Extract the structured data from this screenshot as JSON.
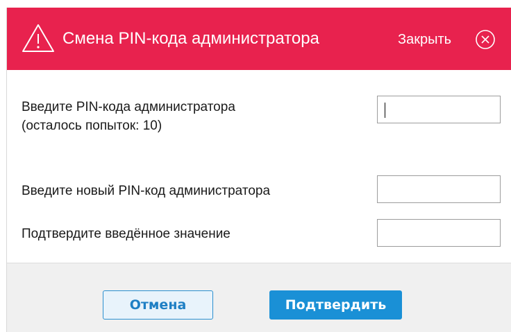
{
  "dialog": {
    "title": "Смена PIN-кода администратора",
    "close_label": "Закрыть",
    "header_color": "#e8224e",
    "icons": {
      "warning": "warning-icon",
      "close": "close-circle-icon"
    }
  },
  "fields": [
    {
      "label_line1": "Введите PIN-кода администратора",
      "label_line2": "(осталось попыток: 10)",
      "value": ""
    },
    {
      "label": "Введите новый PIN-код администратора",
      "value": ""
    },
    {
      "label": "Подтвердите введённое значение",
      "value": ""
    }
  ],
  "buttons": {
    "cancel_label": "Отмена",
    "confirm_label": "Подтвердить",
    "accent_color": "#1a90d6"
  }
}
